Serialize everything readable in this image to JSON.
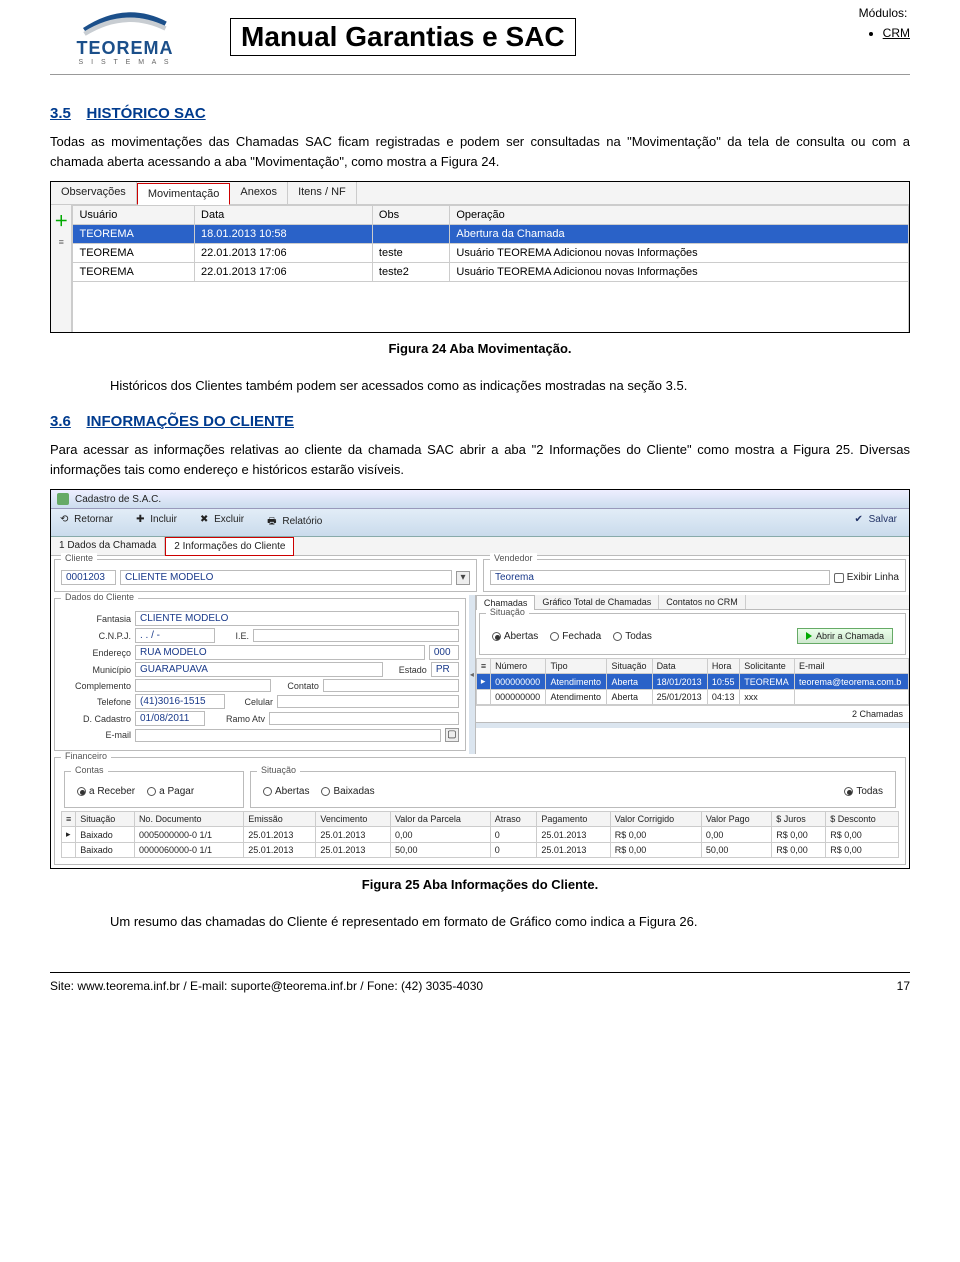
{
  "header": {
    "logo_name": "TEOREMA",
    "logo_sub": "S I S T E M A S",
    "title": "Manual Garantias e SAC",
    "modules_label": "Módulos:",
    "modules": [
      "CRM"
    ]
  },
  "section35": {
    "num": "3.5",
    "title": "HISTÓRICO SAC",
    "para": "Todas as movimentações das Chamadas SAC ficam registradas e podem ser consultadas na \"Movimentação\" da tela de consulta ou com a chamada aberta acessando a aba \"Movimentação\", como mostra a Figura 24."
  },
  "fig24": {
    "tabs": [
      "Observações",
      "Movimentação",
      "Anexos",
      "Itens / NF"
    ],
    "selected_tab_index": 1,
    "columns": [
      "Usuário",
      "Data",
      "Obs",
      "Operação"
    ],
    "rows": [
      {
        "usuario": "TEOREMA",
        "data": "18.01.2013 10:58",
        "obs": "",
        "op": "Abertura da Chamada",
        "selected": true
      },
      {
        "usuario": "TEOREMA",
        "data": "22.01.2013 17:06",
        "obs": "teste",
        "op": "Usuário TEOREMA Adicionou novas Informações",
        "selected": false
      },
      {
        "usuario": "TEOREMA",
        "data": "22.01.2013 17:06",
        "obs": "teste2",
        "op": "Usuário TEOREMA Adicionou novas Informações",
        "selected": false
      }
    ],
    "caption": "Figura 24 Aba Movimentação."
  },
  "mid_para": "Históricos dos Clientes também podem ser acessados como as indicações mostradas na seção 3.5.",
  "section36": {
    "num": "3.6",
    "title": "INFORMAÇÕES DO CLIENTE",
    "para": "Para acessar as informações relativas ao cliente da chamada SAC abrir a aba \"2 Informações do Cliente\" como mostra a Figura 25. Diversas informações tais como endereço e históricos estarão visíveis."
  },
  "fig25": {
    "window_title": "Cadastro de S.A.C.",
    "toolbar": {
      "retornar": "Retornar",
      "incluir": "Incluir",
      "excluir": "Excluir",
      "relatorio": "Relatório",
      "salvar": "Salvar"
    },
    "main_tabs": [
      "1 Dados da Chamada",
      "2 Informações do Cliente"
    ],
    "selected_main_tab": 1,
    "cliente": {
      "label": "Cliente",
      "code": "0001203",
      "name": "CLIENTE MODELO"
    },
    "vendedor": {
      "label": "Vendedor",
      "value": "Teorema"
    },
    "exibir_linha": "Exibir Linha",
    "dados_cliente": {
      "title": "Dados do Cliente",
      "fields": {
        "fantasia_lbl": "Fantasia",
        "fantasia": "CLIENTE MODELO",
        "cnpj_lbl": "C.N.P.J.",
        "cnpj": ". . / -",
        "ie_lbl": "I.E.",
        "ie": "",
        "endereco_lbl": "Endereço",
        "endereco": "RUA MODELO",
        "end_num": "000",
        "municipio_lbl": "Município",
        "municipio": "GUARAPUAVA",
        "estado_lbl": "Estado",
        "estado": "PR",
        "complemento_lbl": "Complemento",
        "complemento": "",
        "contato_lbl": "Contato",
        "contato": "",
        "telefone_lbl": "Telefone",
        "telefone": "(41)3016-1515",
        "celular_lbl": "Celular",
        "celular": "",
        "dcad_lbl": "D. Cadastro",
        "dcad": "01/08/2011",
        "ramo_lbl": "Ramo Atv",
        "ramo": "",
        "email_lbl": "E-mail",
        "email": ""
      }
    },
    "right_tabs": [
      "Chamadas",
      "Gráfico Total de Chamadas",
      "Contatos no CRM"
    ],
    "right_tab_sel": 0,
    "situacao": {
      "title": "Situação",
      "opts": [
        "Abertas",
        "Fechada",
        "Todas"
      ],
      "sel": 0
    },
    "abrir_chamada_btn": "Abrir a Chamada",
    "chamadas_grid": {
      "cols": [
        "Número",
        "Tipo",
        "Situação",
        "Data",
        "Hora",
        "Solicitante",
        "E-mail"
      ],
      "rows": [
        {
          "numero": "000000000",
          "tipo": "Atendimento",
          "sit": "Aberta",
          "data": "18/01/2013",
          "hora": "10:55",
          "sol": "TEOREMA",
          "email": "teorema@teorema.com.b",
          "sel": true
        },
        {
          "numero": "000000000",
          "tipo": "Atendimento",
          "sit": "Aberta",
          "data": "25/01/2013",
          "hora": "04:13",
          "sol": "xxx",
          "email": "",
          "sel": false
        }
      ],
      "count": "2 Chamadas"
    },
    "fin": {
      "title": "Financeiro",
      "contas": {
        "title": "Contas",
        "opts": [
          "a Receber",
          "a Pagar"
        ],
        "sel": 0
      },
      "situacao": {
        "title": "Situação",
        "opts": [
          "Abertas",
          "Baixadas",
          "Todas"
        ],
        "sel": 2
      },
      "grid": {
        "cols": [
          "Situação",
          "No. Documento",
          "Emissão",
          "Vencimento",
          "Valor da Parcela",
          "Atraso",
          "Pagamento",
          "Valor Corrigido",
          "Valor Pago",
          "$ Juros",
          "$ Desconto"
        ],
        "rows": [
          {
            "sit": "Baixado",
            "doc": "0005000000-0 1/1",
            "emi": "25.01.2013",
            "venc": "25.01.2013",
            "vp": "0,00",
            "atr": "0",
            "pag": "25.01.2013",
            "vc": "R$ 0,00",
            "vpg": "0,00",
            "jur": "R$ 0,00",
            "desc": "R$ 0,00"
          },
          {
            "sit": "Baixado",
            "doc": "0000060000-0 1/1",
            "emi": "25.01.2013",
            "venc": "25.01.2013",
            "vp": "50,00",
            "atr": "0",
            "pag": "25.01.2013",
            "vc": "R$ 0,00",
            "vpg": "50,00",
            "jur": "R$ 0,00",
            "desc": "R$ 0,00"
          }
        ]
      }
    },
    "caption": "Figura 25 Aba Informações do Cliente."
  },
  "end_para": "Um resumo das chamadas do Cliente é representado em formato de Gráfico como indica a Figura 26.",
  "footer": {
    "left": "Site: www.teorema.inf.br / E-mail: suporte@teorema.inf.br / Fone: (42) 3035-4030",
    "right": "17"
  }
}
